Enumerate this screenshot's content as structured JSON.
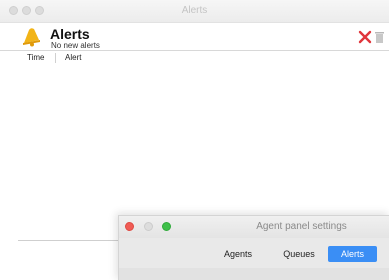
{
  "window": {
    "title": "Alerts"
  },
  "header": {
    "title": "Alerts",
    "subtitle": "No new alerts",
    "icon": "bell-icon",
    "actions": [
      {
        "name": "clear-alerts",
        "icon": "close-icon",
        "color": "#e0353b"
      },
      {
        "name": "delete-alerts",
        "icon": "trash-icon",
        "color": "#b8b8b8"
      }
    ]
  },
  "table": {
    "columns": [
      "Time",
      "Alert"
    ],
    "rows": []
  },
  "panel": {
    "title": "Agent panel settings",
    "tabs": [
      {
        "label": "Agents",
        "active": false
      },
      {
        "label": "Queues",
        "active": false
      },
      {
        "label": "Alerts",
        "active": true
      }
    ]
  },
  "colors": {
    "accent": "#3a8ef5",
    "bell": "#f2b417",
    "close_dot": "#f05c55",
    "zoom_dot": "#3fc04a"
  }
}
